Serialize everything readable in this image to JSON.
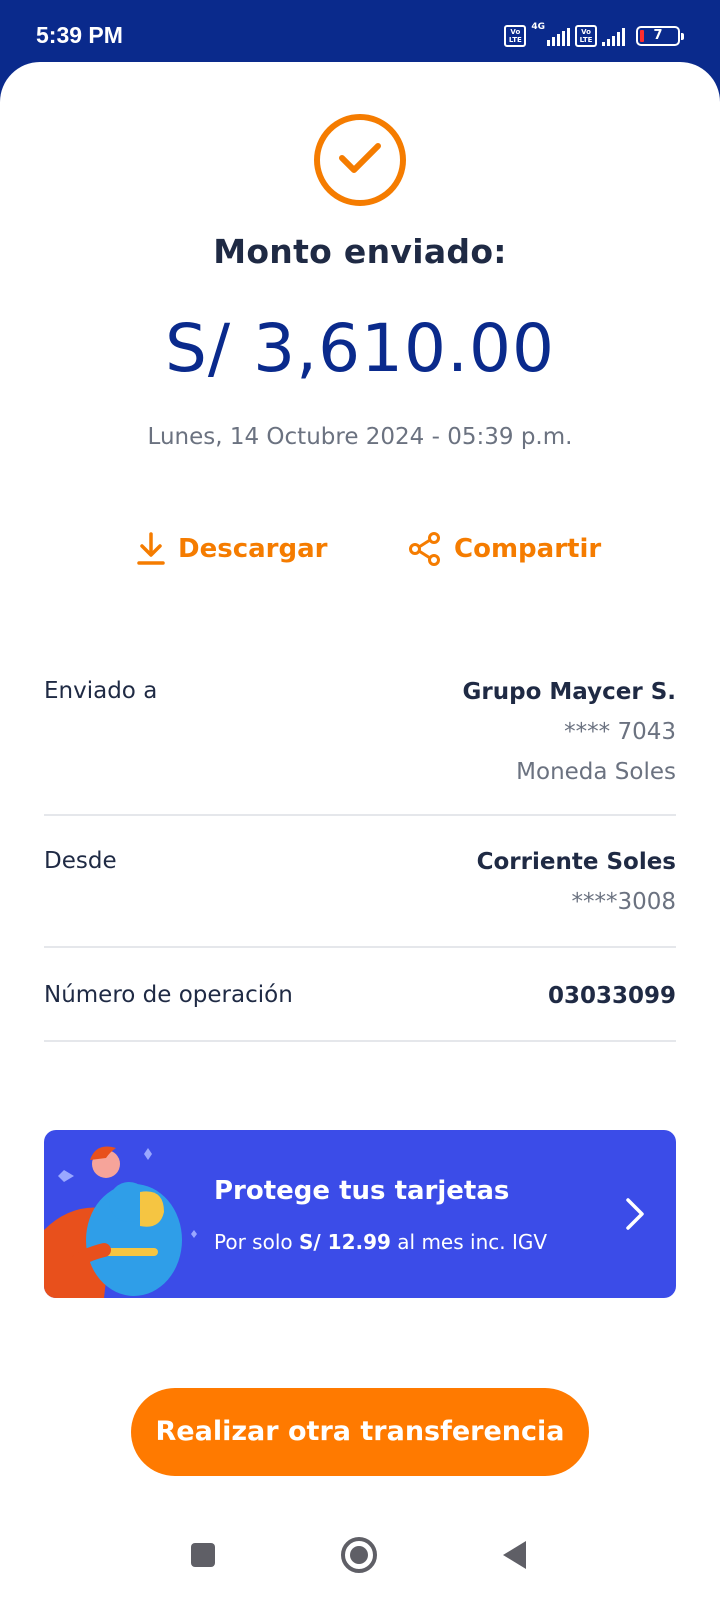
{
  "status_bar": {
    "time": "5:39 PM",
    "volte_label": "Vo LTE",
    "network_type": "4G",
    "battery_level": "7"
  },
  "receipt": {
    "title": "Monto enviado:",
    "amount": "S/ 3,610.00",
    "date": "Lunes, 14 Octubre 2024 - 05:39 p.m."
  },
  "actions": {
    "download_label": "Descargar",
    "share_label": "Compartir"
  },
  "details": {
    "sent_to_label": "Enviado a",
    "sent_to_name": "Grupo Maycer S.",
    "sent_to_account": "**** 7043",
    "sent_to_currency": "Moneda Soles",
    "from_label": "Desde",
    "from_account_name": "Corriente Soles",
    "from_account_number": "****3008",
    "operation_label": "Número de operación",
    "operation_number": "03033099"
  },
  "banner": {
    "title": "Protege tus tarjetas",
    "sub_prefix": "Por solo ",
    "sub_price": "S/ 12.99",
    "sub_suffix": " al mes inc. IGV"
  },
  "cta_label": "Realizar otra transferencia",
  "colors": {
    "brand_blue": "#0a2a8c",
    "accent_orange": "#f57c00",
    "banner_blue": "#3b4ce8"
  }
}
